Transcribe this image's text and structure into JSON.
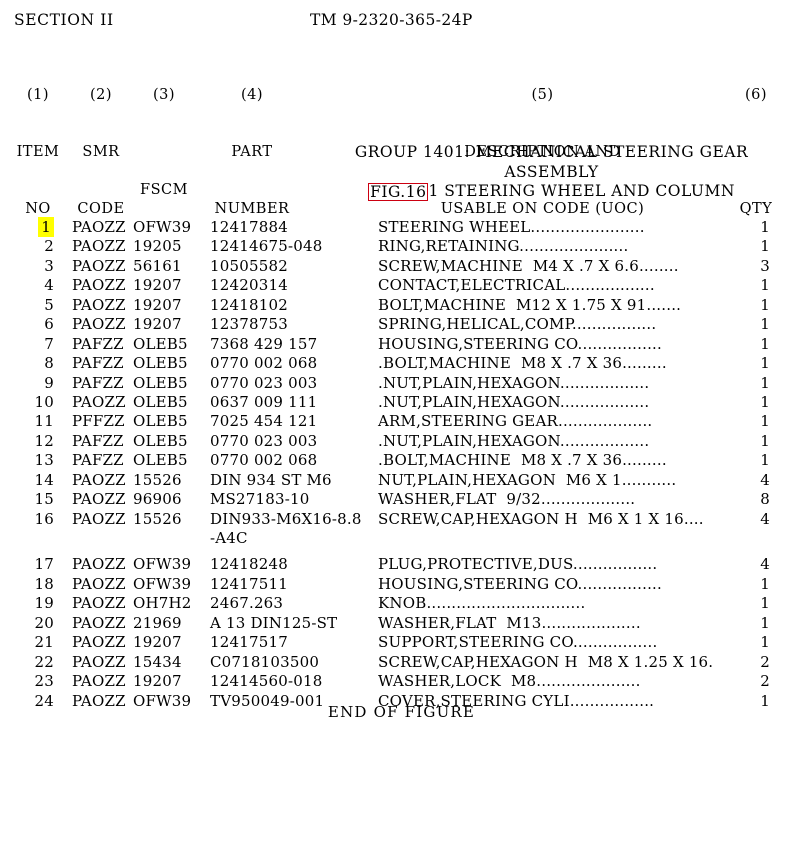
{
  "header": {
    "section": "SECTION II",
    "tm_number": "TM 9-2320-365-24P"
  },
  "columns": [
    {
      "number": "(1)",
      "line1": "ITEM",
      "line2": "NO"
    },
    {
      "number": "(2)",
      "line1": "SMR",
      "line2": "CODE"
    },
    {
      "number": "(3)",
      "line1": "",
      "line2": "FSCM"
    },
    {
      "number": "(4)",
      "line1": "PART",
      "line2": "NUMBER"
    },
    {
      "number": "(5)",
      "line1": "DESCRIPTION AND",
      "line2": "USABLE ON CODE (UOC)"
    },
    {
      "number": "(6)",
      "line1": "",
      "line2": "QTY"
    }
  ],
  "group": {
    "line1": "GROUP 1401: MECHANICAL STEERING GEAR",
    "line2": "ASSEMBLY",
    "fig_boxed": "FIG.16",
    "fig_rest": "1 STEERING WHEEL AND COLUMN",
    "fig_box_color": "#cc0011"
  },
  "highlight": {
    "color": "#ffff00",
    "item_no": "1"
  },
  "rows": [
    {
      "item": "1",
      "highlighted": true,
      "smr": "PAOZZ",
      "fscm": "OFW39",
      "part": "12417884",
      "desc": "STEERING WHEEL.......................",
      "qty": "1"
    },
    {
      "item": "2",
      "highlighted": false,
      "smr": "PAOZZ",
      "fscm": "19205",
      "part": "12414675-048",
      "desc": "RING,RETAINING......................",
      "qty": "1"
    },
    {
      "item": "3",
      "highlighted": false,
      "smr": "PAOZZ",
      "fscm": "56161",
      "part": "10505582",
      "desc": "SCREW,MACHINE  M4 X .7 X 6.6........",
      "qty": "3"
    },
    {
      "item": "4",
      "highlighted": false,
      "smr": "PAOZZ",
      "fscm": "19207",
      "part": "12420314",
      "desc": "CONTACT,ELECTRICAL..................",
      "qty": "1"
    },
    {
      "item": "5",
      "highlighted": false,
      "smr": "PAOZZ",
      "fscm": "19207",
      "part": "12418102",
      "desc": "BOLT,MACHINE  M12 X 1.75 X 91.......",
      "qty": "1"
    },
    {
      "item": "6",
      "highlighted": false,
      "smr": "PAOZZ",
      "fscm": "19207",
      "part": "12378753",
      "desc": "SPRING,HELICAL,COMP.................",
      "qty": "1"
    },
    {
      "item": "7",
      "highlighted": false,
      "smr": "PAFZZ",
      "fscm": "OLEB5",
      "part": "7368 429 157",
      "desc": "HOUSING,STEERING CO.................",
      "qty": "1"
    },
    {
      "item": "8",
      "highlighted": false,
      "smr": "PAFZZ",
      "fscm": "OLEB5",
      "part": "0770 002 068",
      "desc": ".BOLT,MACHINE  M8 X .7 X 36.........",
      "qty": "1"
    },
    {
      "item": "9",
      "highlighted": false,
      "smr": "PAFZZ",
      "fscm": "OLEB5",
      "part": "0770 023 003",
      "desc": ".NUT,PLAIN,HEXAGON..................",
      "qty": "1"
    },
    {
      "item": "10",
      "highlighted": false,
      "smr": "PAOZZ",
      "fscm": "OLEB5",
      "part": "0637 009 111",
      "desc": ".NUT,PLAIN,HEXAGON..................",
      "qty": "1"
    },
    {
      "item": "11",
      "highlighted": false,
      "smr": "PFFZZ",
      "fscm": "OLEB5",
      "part": "7025 454 121",
      "desc": "ARM,STEERING GEAR...................",
      "qty": "1"
    },
    {
      "item": "12",
      "highlighted": false,
      "smr": "PAFZZ",
      "fscm": "OLEB5",
      "part": "0770 023 003",
      "desc": ".NUT,PLAIN,HEXAGON..................",
      "qty": "1"
    },
    {
      "item": "13",
      "highlighted": false,
      "smr": "PAFZZ",
      "fscm": "OLEB5",
      "part": "0770 002 068",
      "desc": ".BOLT,MACHINE  M8 X .7 X 36.........",
      "qty": "1"
    },
    {
      "item": "14",
      "highlighted": false,
      "smr": "PAOZZ",
      "fscm": "15526",
      "part": "DIN 934 ST M6",
      "desc": "NUT,PLAIN,HEXAGON  M6 X 1...........",
      "qty": "4"
    },
    {
      "item": "15",
      "highlighted": false,
      "smr": "PAOZZ",
      "fscm": "96906",
      "part": "MS27183-10",
      "desc": "WASHER,FLAT  9/32...................",
      "qty": "8"
    },
    {
      "item": "16",
      "highlighted": false,
      "smr": "PAOZZ",
      "fscm": "15526",
      "part": "DIN933-M6X16-8.8",
      "part_cont": "-A4C",
      "desc": "SCREW,CAP,HEXAGON H  M6 X 1 X 16....",
      "qty": "4"
    },
    {
      "item": "17",
      "highlighted": false,
      "smr": "PAOZZ",
      "fscm": "OFW39",
      "part": "12418248",
      "desc": "PLUG,PROTECTIVE,DUS.................",
      "qty": "4"
    },
    {
      "item": "18",
      "highlighted": false,
      "smr": "PAOZZ",
      "fscm": "OFW39",
      "part": "12417511",
      "desc": "HOUSING,STEERING CO.................",
      "qty": "1"
    },
    {
      "item": "19",
      "highlighted": false,
      "smr": "PAOZZ",
      "fscm": "OH7H2",
      "part": "2467.263",
      "desc": "KNOB................................",
      "qty": "1"
    },
    {
      "item": "20",
      "highlighted": false,
      "smr": "PAOZZ",
      "fscm": "21969",
      "part": "A 13 DIN125-ST",
      "desc": "WASHER,FLAT  M13....................",
      "qty": "1"
    },
    {
      "item": "21",
      "highlighted": false,
      "smr": "PAOZZ",
      "fscm": "19207",
      "part": "12417517",
      "desc": "SUPPORT,STEERING CO.................",
      "qty": "1"
    },
    {
      "item": "22",
      "highlighted": false,
      "smr": "PAOZZ",
      "fscm": "15434",
      "part": "C0718103500",
      "desc": "SCREW,CAP,HEXAGON H  M8 X 1.25 X 16.",
      "qty": "2"
    },
    {
      "item": "23",
      "highlighted": false,
      "smr": "PAOZZ",
      "fscm": "19207",
      "part": "12414560-018",
      "desc": "WASHER,LOCK  M8.....................",
      "qty": "2"
    },
    {
      "item": "24",
      "highlighted": false,
      "smr": "PAOZZ",
      "fscm": "OFW39",
      "part": "TV950049-001",
      "desc": "COVER,STEERING CYLI.................",
      "qty": "1"
    }
  ],
  "footer": {
    "text": "END OF FIGURE"
  }
}
